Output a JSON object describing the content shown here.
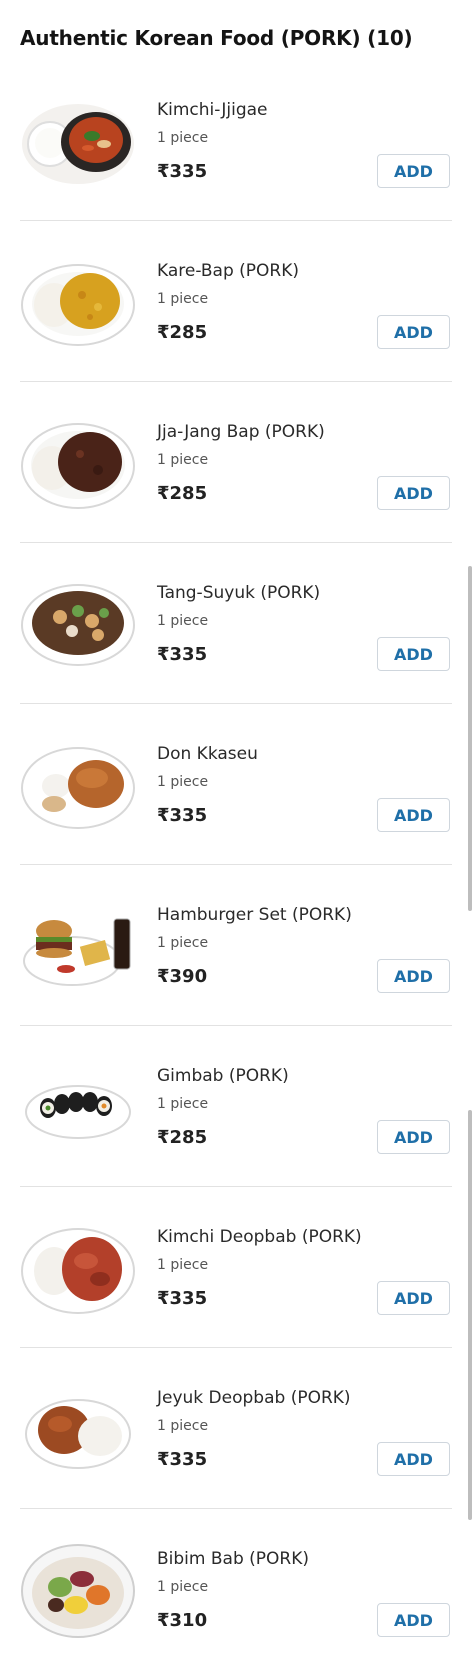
{
  "section": {
    "title": "Authentic Korean Food (PORK) (10)"
  },
  "items": [
    {
      "name": "Kimchi-Jjigae",
      "qty": "1 piece",
      "price": "₹335",
      "add_label": "ADD",
      "image": "kimchi-jjigae"
    },
    {
      "name": "Kare-Bap (PORK)",
      "qty": "1 piece",
      "price": "₹285",
      "add_label": "ADD",
      "image": "kare-bap"
    },
    {
      "name": "Jja-Jang Bap (PORK)",
      "qty": "1 piece",
      "price": "₹285",
      "add_label": "ADD",
      "image": "jja-jang-bap"
    },
    {
      "name": "Tang-Suyuk (PORK)",
      "qty": "1 piece",
      "price": "₹335",
      "add_label": "ADD",
      "image": "tang-suyuk"
    },
    {
      "name": "Don Kkaseu",
      "qty": "1 piece",
      "price": "₹335",
      "add_label": "ADD",
      "image": "don-kkaseu"
    },
    {
      "name": "Hamburger Set (PORK)",
      "qty": "1 piece",
      "price": "₹390",
      "add_label": "ADD",
      "image": "hamburger-set"
    },
    {
      "name": "Gimbab (PORK)",
      "qty": "1 piece",
      "price": "₹285",
      "add_label": "ADD",
      "image": "gimbab"
    },
    {
      "name": "Kimchi Deopbab (PORK)",
      "qty": "1 piece",
      "price": "₹335",
      "add_label": "ADD",
      "image": "kimchi-deopbab"
    },
    {
      "name": "Jeyuk Deopbab (PORK)",
      "qty": "1 piece",
      "price": "₹335",
      "add_label": "ADD",
      "image": "jeyuk-deopbab"
    },
    {
      "name": "Bibim Bab (PORK)",
      "qty": "1 piece",
      "price": "₹310",
      "add_label": "ADD",
      "image": "bibim-bab"
    }
  ],
  "colors": {
    "add_text": "#1f6fa8",
    "add_border": "#cfd6dd",
    "divider": "#e2e2e2"
  }
}
